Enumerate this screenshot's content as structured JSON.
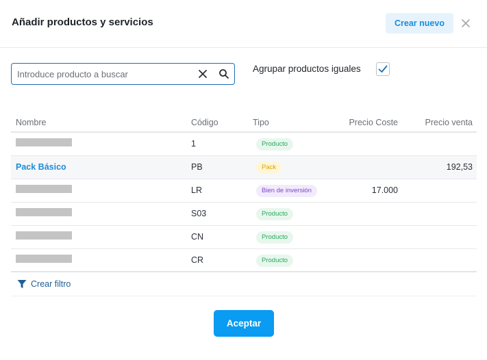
{
  "header": {
    "title": "Añadir productos y servicios",
    "create_new_label": "Crear nuevo",
    "close_icon": "close-icon"
  },
  "search": {
    "value": "",
    "placeholder": "Introduce producto a buscar",
    "clear_icon": "clear-icon",
    "search_icon": "search-icon"
  },
  "group": {
    "label": "Agrupar productos iguales",
    "checked": true
  },
  "table": {
    "columns": {
      "name": "Nombre",
      "code": "Código",
      "type": "Tipo",
      "cost": "Precio Coste",
      "sale": "Precio venta"
    },
    "rows": [
      {
        "name": "",
        "redacted": true,
        "code": "1",
        "type": "Producto",
        "cost": "",
        "sale": ""
      },
      {
        "name": "Pack Básico",
        "redacted": false,
        "code": "PB",
        "type": "Pack",
        "cost": "",
        "sale": "192,53"
      },
      {
        "name": "",
        "redacted": true,
        "code": "LR",
        "type": "Bien de inversión",
        "cost": "17.000",
        "sale": ""
      },
      {
        "name": "",
        "redacted": true,
        "code": "S03",
        "type": "Producto",
        "cost": "",
        "sale": ""
      },
      {
        "name": "",
        "redacted": true,
        "code": "CN",
        "type": "Producto",
        "cost": "",
        "sale": ""
      },
      {
        "name": "",
        "redacted": true,
        "code": "CR",
        "type": "Producto",
        "cost": "",
        "sale": ""
      }
    ]
  },
  "filter": {
    "label": "Crear filtro",
    "icon": "filter-icon"
  },
  "footer": {
    "accept_label": "Aceptar"
  },
  "colors": {
    "accent": "#0a9bf2",
    "link": "#1a8ddb",
    "badge_producto_bg": "#e8f7ee",
    "badge_producto_fg": "#27a75a",
    "badge_pack_bg": "#fff6d6",
    "badge_pack_fg": "#d9a400",
    "badge_bien_bg": "#f1ebfb",
    "badge_bien_fg": "#7b45c9"
  }
}
